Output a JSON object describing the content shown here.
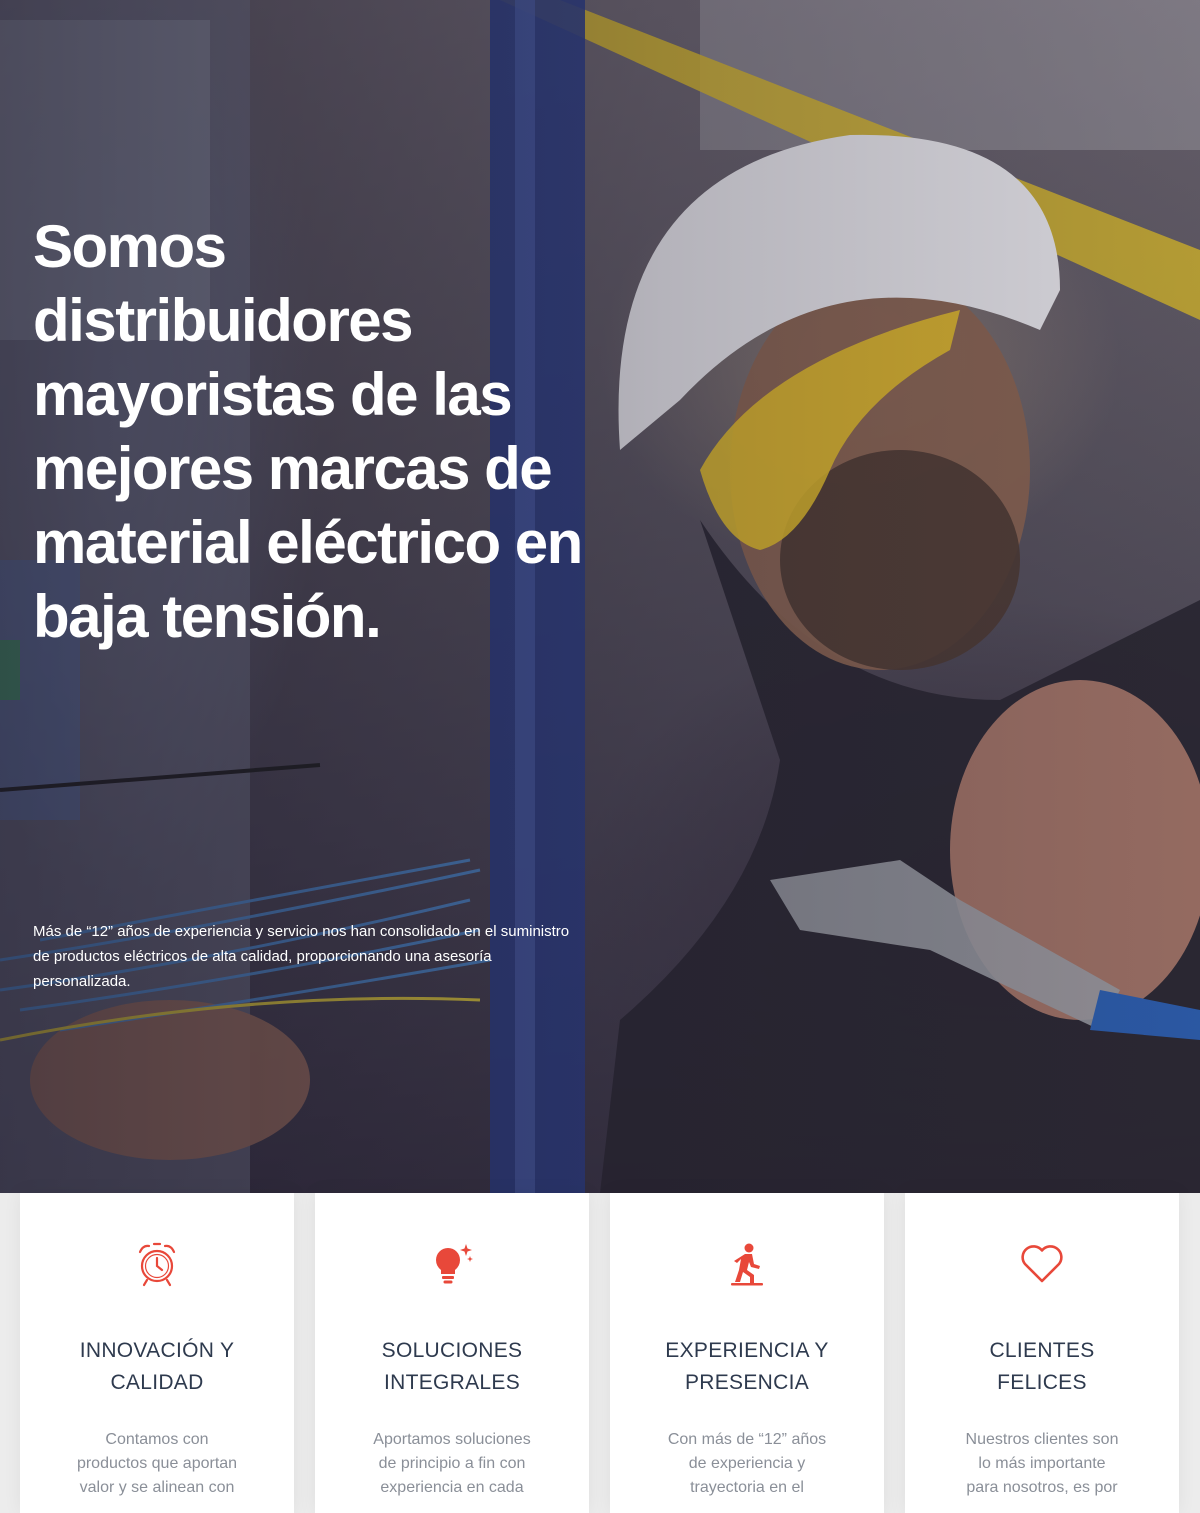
{
  "hero": {
    "title": "Somos distribuidores mayoristas de las mejores marcas de material eléctrico en baja tensión.",
    "text": "Más de “12” años de experiencia y servicio nos han consolidado en el suministro de productos eléctricos de alta calidad, proporcionando una asesoría personalizada."
  },
  "colors": {
    "accent": "#e8483a",
    "title": "#2e3a4e",
    "text": "#8a8f98"
  },
  "features": [
    {
      "icon": "alarm-clock-icon",
      "title_line1": "INNOVACIÓN Y",
      "title_line2": "CALIDAD",
      "desc_lines": [
        "Contamos con",
        "productos que aportan",
        "valor y se alinean con"
      ]
    },
    {
      "icon": "lightbulb-icon",
      "title_line1": "SOLUCIONES",
      "title_line2": "INTEGRALES",
      "desc_lines": [
        "Aportamos soluciones",
        "de principio a fin con",
        "experiencia en cada"
      ]
    },
    {
      "icon": "walking-person-icon",
      "title_line1": "EXPERIENCIA Y",
      "title_line2": "PRESENCIA",
      "desc_lines": [
        "Con más de “12” años",
        "de experiencia y",
        "trayectoria en el"
      ]
    },
    {
      "icon": "heart-icon",
      "title_line1": "CLIENTES",
      "title_line2": "FELICES",
      "desc_lines": [
        "Nuestros clientes son",
        "lo más importante",
        "para nosotros, es por"
      ]
    }
  ]
}
